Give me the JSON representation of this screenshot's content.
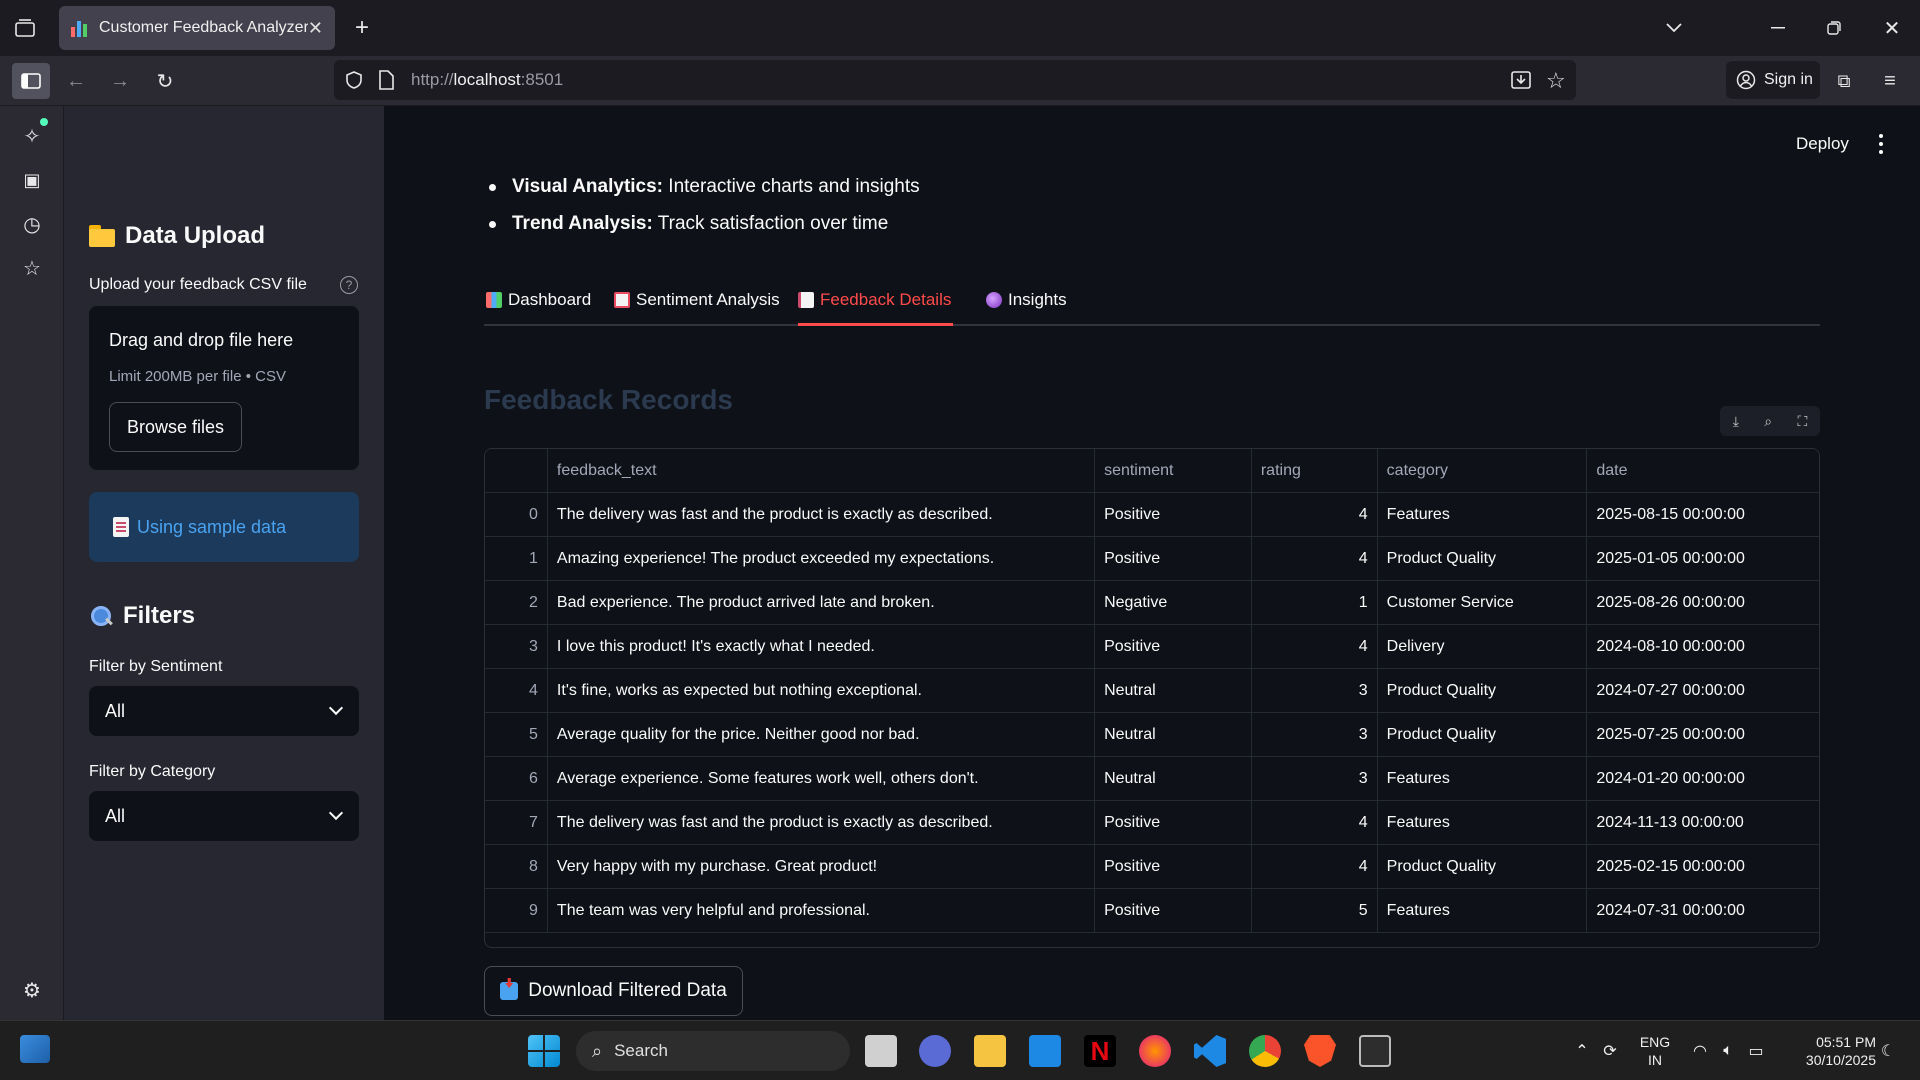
{
  "browser": {
    "tab_title": "Customer Feedback Analyzer",
    "url_prefix": "http://",
    "url_host": "localhost",
    "url_port": ":8501",
    "signin_label": "Sign in"
  },
  "sidebar": {
    "upload_title": "Data Upload",
    "upload_label": "Upload your feedback CSV file",
    "dropzone_title": "Drag and drop file here",
    "dropzone_limit": "Limit 200MB per file • CSV",
    "browse_label": "Browse files",
    "sample_notice": "Using sample data",
    "filters_title": "Filters",
    "sentiment_label": "Filter by Sentiment",
    "sentiment_value": "All",
    "category_label": "Filter by Category",
    "category_value": "All"
  },
  "header": {
    "deploy_label": "Deploy"
  },
  "features": [
    {
      "name": "Visual Analytics:",
      "desc": " Interactive charts and insights"
    },
    {
      "name": "Trend Analysis:",
      "desc": " Track satisfaction over time"
    }
  ],
  "tabs": [
    {
      "label": "Dashboard",
      "icon_color": "#4dabf7"
    },
    {
      "label": "Sentiment Analysis",
      "icon_color": "#e8e8e8"
    },
    {
      "label": "Feedback Details",
      "icon_color": "#f4f4f4"
    },
    {
      "label": "Insights",
      "icon_color": "#9b59b6"
    }
  ],
  "records": {
    "title": "Feedback Records",
    "columns": [
      "",
      "feedback_text",
      "sentiment",
      "rating",
      "category",
      "date"
    ],
    "rows": [
      [
        "0",
        "The delivery was fast and the product is exactly as described.",
        "Positive",
        "4",
        "Features",
        "2025-08-15 00:00:00"
      ],
      [
        "1",
        "Amazing experience! The product exceeded my expectations.",
        "Positive",
        "4",
        "Product Quality",
        "2025-01-05 00:00:00"
      ],
      [
        "2",
        "Bad experience. The product arrived late and broken.",
        "Negative",
        "1",
        "Customer Service",
        "2025-08-26 00:00:00"
      ],
      [
        "3",
        "I love this product! It's exactly what I needed.",
        "Positive",
        "4",
        "Delivery",
        "2024-08-10 00:00:00"
      ],
      [
        "4",
        "It's fine, works as expected but nothing exceptional.",
        "Neutral",
        "3",
        "Product Quality",
        "2024-07-27 00:00:00"
      ],
      [
        "5",
        "Average quality for the price. Neither good nor bad.",
        "Neutral",
        "3",
        "Product Quality",
        "2025-07-25 00:00:00"
      ],
      [
        "6",
        "Average experience. Some features work well, others don't.",
        "Neutral",
        "3",
        "Features",
        "2024-01-20 00:00:00"
      ],
      [
        "7",
        "The delivery was fast and the product is exactly as described.",
        "Positive",
        "4",
        "Features",
        "2024-11-13 00:00:00"
      ],
      [
        "8",
        "Very happy with my purchase. Great product!",
        "Positive",
        "4",
        "Product Quality",
        "2025-02-15 00:00:00"
      ],
      [
        "9",
        "The team was very helpful and professional.",
        "Positive",
        "5",
        "Features",
        "2024-07-31 00:00:00"
      ]
    ],
    "download_label": "Download Filtered Data"
  },
  "taskbar": {
    "search_label": "Search",
    "lang_top": "ENG",
    "lang_bottom": "IN",
    "time": "05:51 PM",
    "date": "30/10/2025"
  },
  "colors": {
    "accent": "#ff4b4b",
    "info_bg": "#1b3a5c",
    "info_text": "#4aa3f0"
  }
}
